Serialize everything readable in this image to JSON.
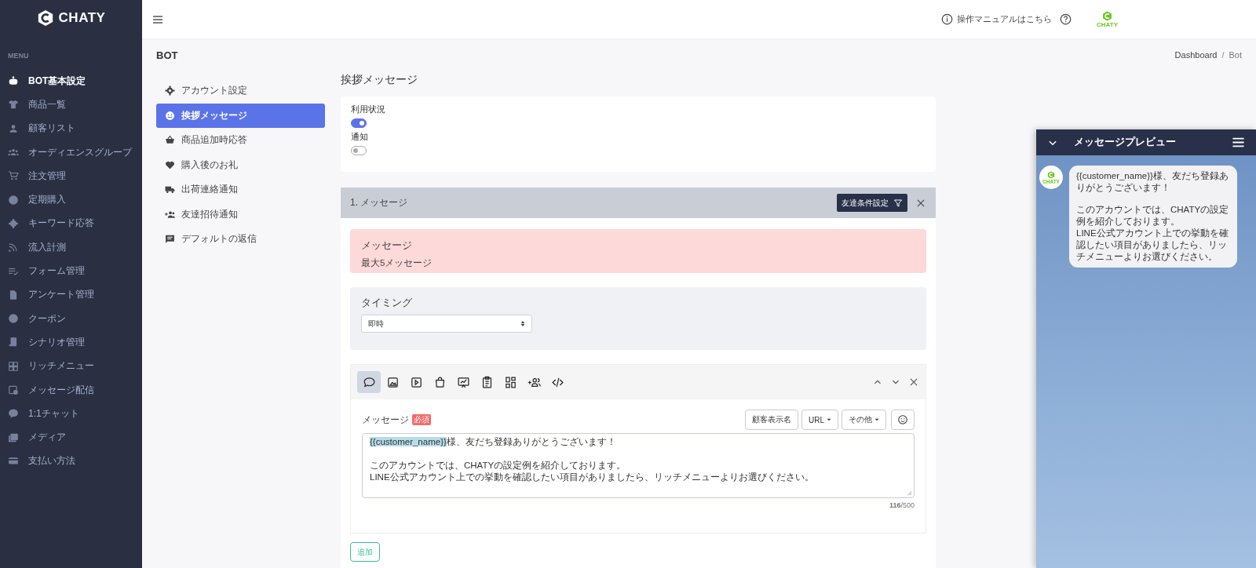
{
  "sidebar": {
    "logo": "CHATY",
    "menu_label": "MENU",
    "items": [
      {
        "label": "BOT基本設定",
        "selected": true
      },
      {
        "label": "商品一覧",
        "selected": false
      },
      {
        "label": "顧客リスト",
        "selected": false
      },
      {
        "label": "オーディエンスグループ",
        "selected": false
      },
      {
        "label": "注文管理",
        "selected": false
      },
      {
        "label": "定期購入",
        "selected": false
      },
      {
        "label": "キーワード応答",
        "selected": false
      },
      {
        "label": "流入計測",
        "selected": false
      },
      {
        "label": "フォーム管理",
        "selected": false
      },
      {
        "label": "アンケート管理",
        "selected": false
      },
      {
        "label": "クーポン",
        "selected": false
      },
      {
        "label": "シナリオ管理",
        "selected": false
      },
      {
        "label": "リッチメニュー",
        "selected": false
      },
      {
        "label": "メッセージ配信",
        "selected": false
      },
      {
        "label": "1:1チャット",
        "selected": false
      },
      {
        "label": "メディア",
        "selected": false
      },
      {
        "label": "支払い方法",
        "selected": false
      }
    ]
  },
  "topbar": {
    "manual_link": "操作マニュアルはこちら",
    "logo": "CHATY"
  },
  "page": {
    "title": "BOT",
    "breadcrumb_separator": "/",
    "breadcrumb": [
      {
        "label": "Dashboard"
      },
      {
        "label": "Bot"
      }
    ]
  },
  "submenu": [
    {
      "label": "アカウント設定",
      "selected": false
    },
    {
      "label": "挨拶メッセージ",
      "selected": true
    },
    {
      "label": "商品追加時応答",
      "selected": false
    },
    {
      "label": "購入後のお礼",
      "selected": false
    },
    {
      "label": "出荷連絡通知",
      "selected": false
    },
    {
      "label": "友達招待通知",
      "selected": false
    },
    {
      "label": "デフォルトの返信",
      "selected": false
    }
  ],
  "section_title": "挨拶メッセージ",
  "settings": [
    {
      "label": "利用状況",
      "on": true
    },
    {
      "label": "通知",
      "on": false
    }
  ],
  "message_block": {
    "title": "1. メッセージ",
    "filter_button": "友達条件設定",
    "alert": {
      "title": "メッセージ",
      "text": "最大5メッセージ"
    },
    "timing": {
      "label": "タイミング",
      "value": "即時"
    },
    "tools": [
      {
        "selected": true
      },
      {
        "selected": false
      },
      {
        "selected": false
      },
      {
        "selected": false
      },
      {
        "selected": false
      },
      {
        "selected": false
      },
      {
        "selected": false
      },
      {
        "selected": false
      },
      {
        "selected": false
      }
    ],
    "field_label": "メッセージ",
    "required_badge": "必須",
    "insert_buttons": [
      {
        "label": "顧客表示名",
        "kind": "plain"
      },
      {
        "label": "URL",
        "kind": "dropdown"
      },
      {
        "label": "その他",
        "kind": "dropdown"
      }
    ],
    "token": "{{customer_name}}",
    "first_line": "様、友だち登録ありがとうございます！",
    "lines": [
      "このアカウントでは、CHATYの設定例を紹介しております。",
      "LINE公式アカウント上での挙動を確認したい項目がありましたら、リッチメニューよりお選びください。"
    ],
    "counter": "**116**/500"
  },
  "add_button": "追加",
  "preview": {
    "title": "メッセージプレビュー",
    "avatar_logo": "CHATY",
    "bubble": [
      "{{customer_name}}様、友だち登録ありがとうございます！",
      "このアカウントでは、CHATYの設定例を紹介しております。",
      "LINE公式アカウント上での挙動を確認したい項目がありましたら、リッチメニューよりお選びください。"
    ]
  }
}
